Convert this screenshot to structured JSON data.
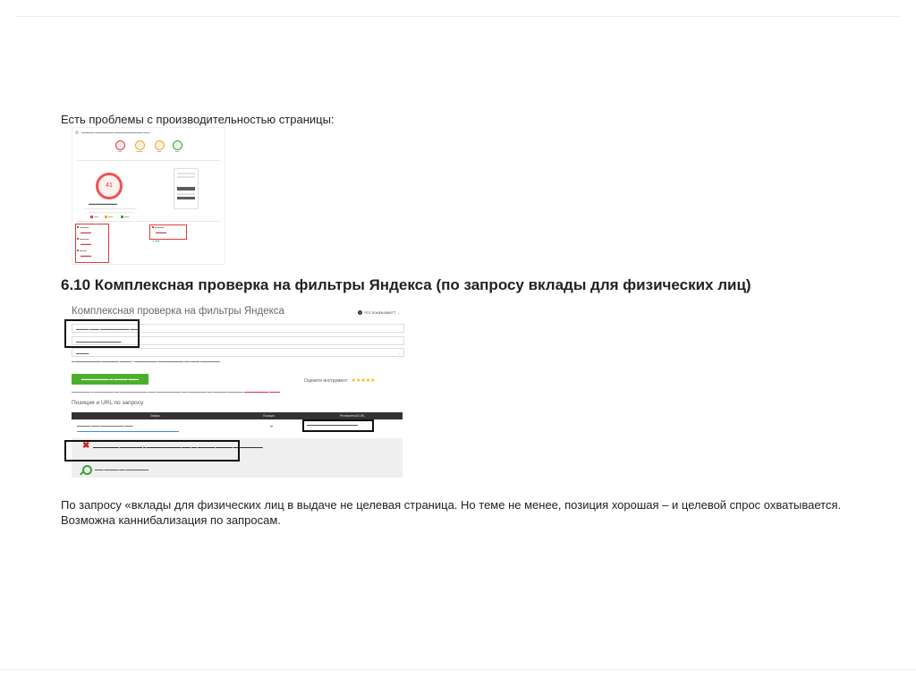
{
  "slide": {
    "intro_text": "Есть проблемы с производительностью страницы:",
    "section_heading": "6.10 Комплексная проверка на фильтры Яндекса (по запросу вклады для физических лиц)",
    "conclusion_text": "По запросу «вклады для физических лиц в выдаче не целевая страница. Но теме не менее, позиция хорошая – и целевой спрос охватывается. Возможна каннибализация по запросам."
  },
  "pagespeed_screenshot": {
    "score": "41",
    "colors": {
      "fail": "#e63a3a",
      "average": "#f5a623",
      "pass": "#3aa33a"
    }
  },
  "yandex_screenshot": {
    "title": "Комплексная проверка на фильтры Яндекса",
    "help_label": "Что показывает?",
    "rating_label": "Оцените инструмент:",
    "rating_stars": "★★★★★",
    "subtitle": "Позиция и URL по запросу",
    "table_headers": [
      "Запрос",
      "Позиция",
      "Релевантный URL"
    ],
    "colors": {
      "button": "#4caf2a",
      "fail_icon": "#d32020",
      "pass_icon": "#3aa33a"
    }
  }
}
